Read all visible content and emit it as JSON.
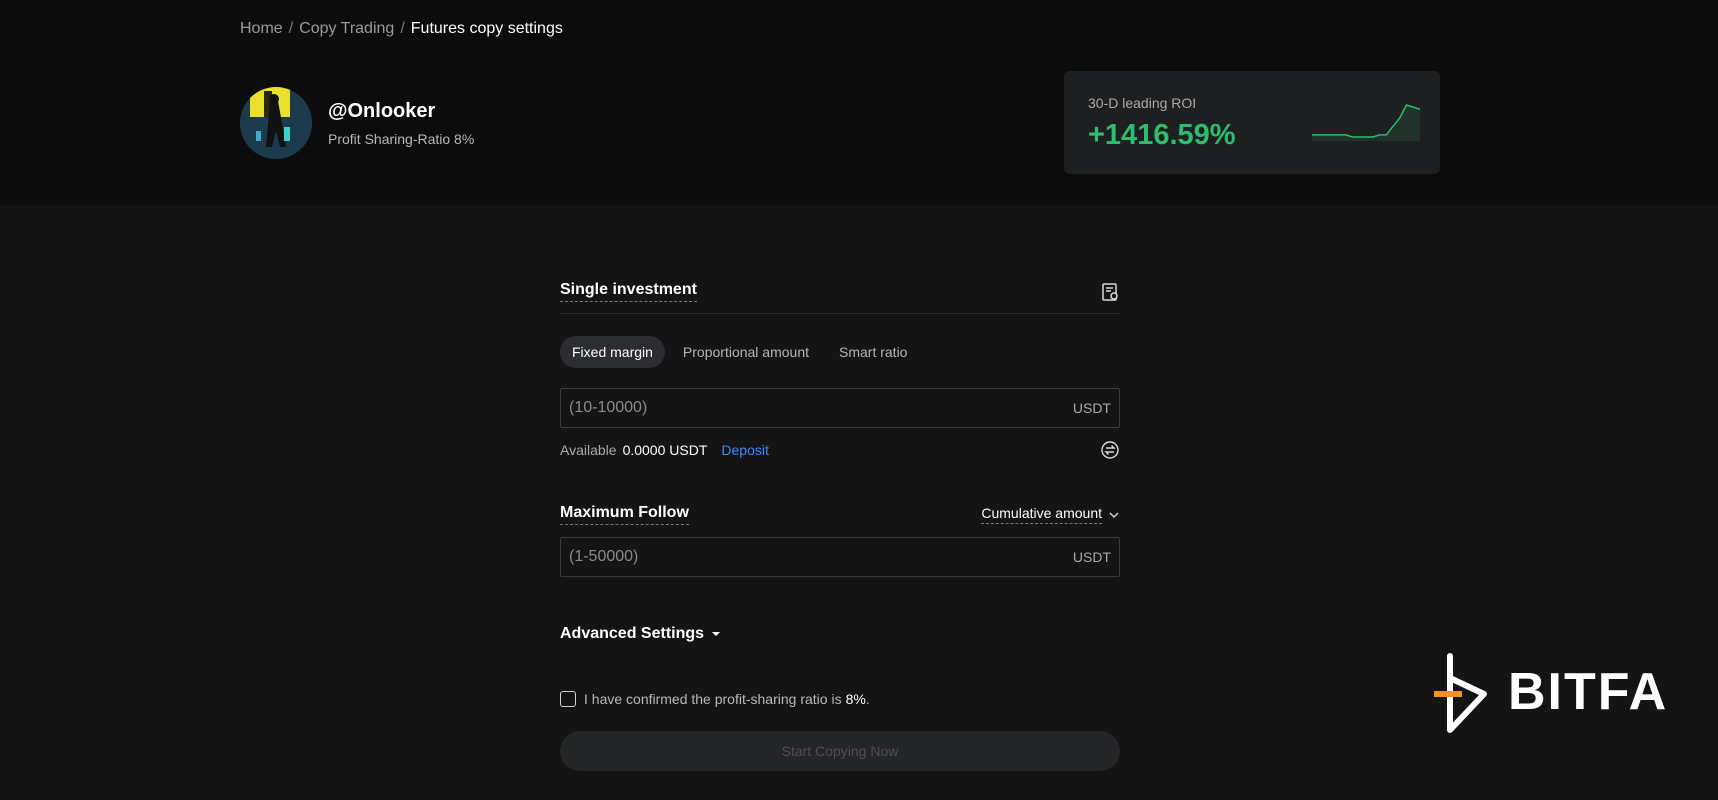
{
  "breadcrumb": {
    "items": [
      "Home",
      "Copy Trading"
    ],
    "current": "Futures copy settings",
    "separator": "/"
  },
  "profile": {
    "username": "@Onlooker",
    "ratio_text": "Profit Sharing-Ratio 8%"
  },
  "roi": {
    "label": "30-D leading ROI",
    "value": "+1416.59%",
    "color": "#2ebd6e",
    "sparkline": [
      0,
      0,
      0,
      0,
      0,
      0,
      -1,
      -1,
      -1,
      -1,
      0,
      0,
      4,
      8,
      14,
      13,
      12
    ]
  },
  "single_investment": {
    "title": "Single investment",
    "tabs": [
      {
        "label": "Fixed margin",
        "active": true
      },
      {
        "label": "Proportional amount",
        "active": false
      },
      {
        "label": "Smart ratio",
        "active": false
      }
    ],
    "input_placeholder": "(10-10000)",
    "unit": "USDT",
    "available_label": "Available",
    "available_value": "0.0000 USDT",
    "deposit_label": "Deposit"
  },
  "maximum_follow": {
    "title": "Maximum Follow",
    "select_label": "Cumulative amount",
    "input_placeholder": "(1-50000)",
    "unit": "USDT"
  },
  "advanced": {
    "label": "Advanced Settings"
  },
  "confirm": {
    "text": "I have confirmed the profit-sharing ratio is",
    "percent": "8%",
    "suffix": "."
  },
  "start_button": {
    "label": "Start Copying Now"
  },
  "watermark": {
    "text": "BITFA",
    "accent": "#f7931a"
  }
}
